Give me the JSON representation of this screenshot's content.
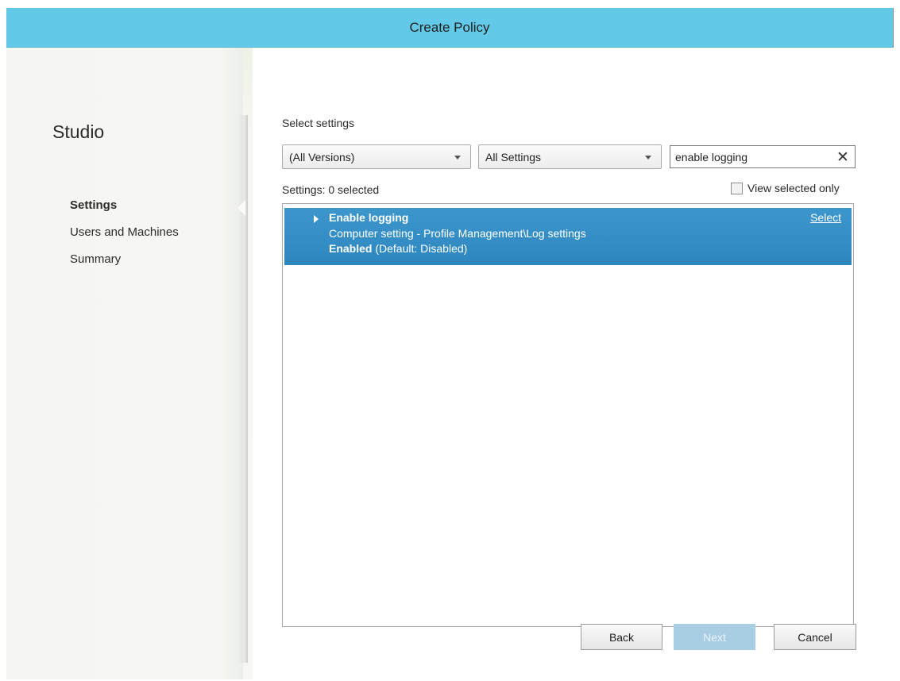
{
  "window": {
    "title": "Create Policy"
  },
  "sidebar": {
    "app_title": "Studio",
    "items": [
      {
        "label": "Settings",
        "active": true
      },
      {
        "label": "Users and Machines",
        "active": false
      },
      {
        "label": "Summary",
        "active": false
      }
    ]
  },
  "main": {
    "section_title": "Select settings",
    "filters": {
      "version_dropdown": "(All Versions)",
      "category_dropdown": "All Settings",
      "search_value": "enable logging",
      "search_clear_icon": "close-icon"
    },
    "selected_count": "Settings: 0 selected",
    "view_selected_only": {
      "label": "View selected only",
      "checked": false
    },
    "results": [
      {
        "name": "Enable logging",
        "path": "Computer setting - Profile Management\\Log settings",
        "state": "Enabled",
        "default": "(Default: Disabled)",
        "action": "Select",
        "expander_icon": "triangle-right-icon"
      }
    ]
  },
  "buttons": {
    "back": "Back",
    "next": "Next",
    "cancel": "Cancel"
  },
  "colors": {
    "titlebar": "#63c9e8",
    "selected_row": "#2f89c1",
    "disabled_button": "#a9cde3"
  }
}
